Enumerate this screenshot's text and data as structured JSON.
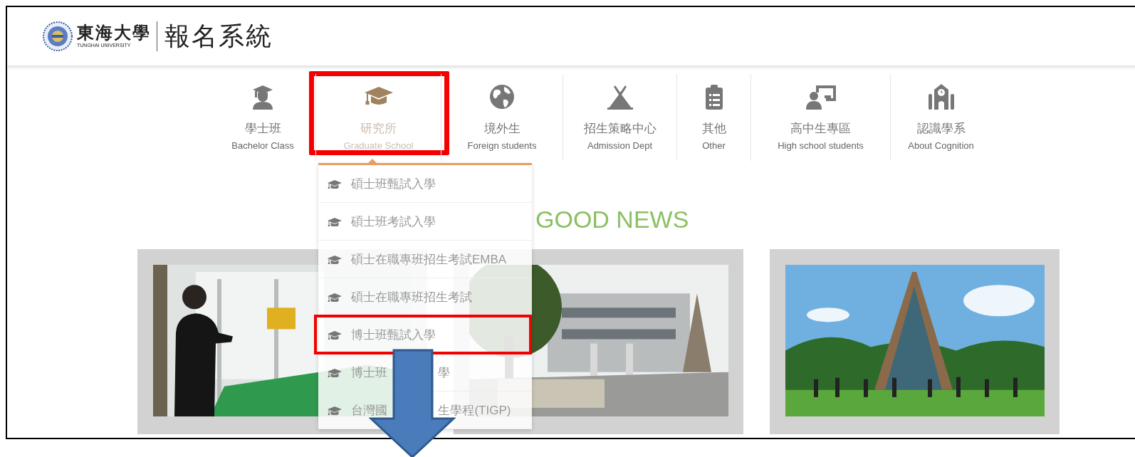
{
  "header": {
    "logo": {
      "name": "東海大學",
      "subtitle": "TUNGHAI UNIVERSITY"
    },
    "title": "報名系統"
  },
  "nav": [
    {
      "label": "學士班",
      "sublabel": "Bachelor Class",
      "kind": "scholar",
      "selected": false
    },
    {
      "label": "研究所",
      "sublabel": "Graduate School",
      "kind": "cap",
      "selected": true
    },
    {
      "label": "境外生",
      "sublabel": "Foreign students",
      "kind": "globe",
      "selected": false
    },
    {
      "label": "招生策略中心",
      "sublabel": "Admission Dept",
      "kind": "tent",
      "selected": false
    },
    {
      "label": "其他",
      "sublabel": "Other",
      "kind": "clipboard",
      "selected": false
    },
    {
      "label": "高中生專區",
      "sublabel": "High school students",
      "kind": "teacher",
      "selected": false
    },
    {
      "label": "認識學系",
      "sublabel": "About Cognition",
      "kind": "building",
      "selected": false
    }
  ],
  "dropdown": [
    {
      "parts": [
        "碩士班甄試入學"
      ],
      "highlighted": false
    },
    {
      "parts": [
        "碩士班考試入學"
      ],
      "highlighted": false
    },
    {
      "parts": [
        "碩士在職專班招生考試EMBA"
      ],
      "highlighted": false
    },
    {
      "parts": [
        "碩士在職專班招生考試"
      ],
      "highlighted": false
    },
    {
      "parts": [
        "博士班甄試入學"
      ],
      "highlighted": true
    },
    {
      "parts": [
        "博士班",
        "學"
      ],
      "highlighted": false
    },
    {
      "parts": [
        "台灣國",
        "生學程(TIGP)"
      ],
      "highlighted": false
    }
  ],
  "news": {
    "heading": "GOOD NEWS"
  }
}
